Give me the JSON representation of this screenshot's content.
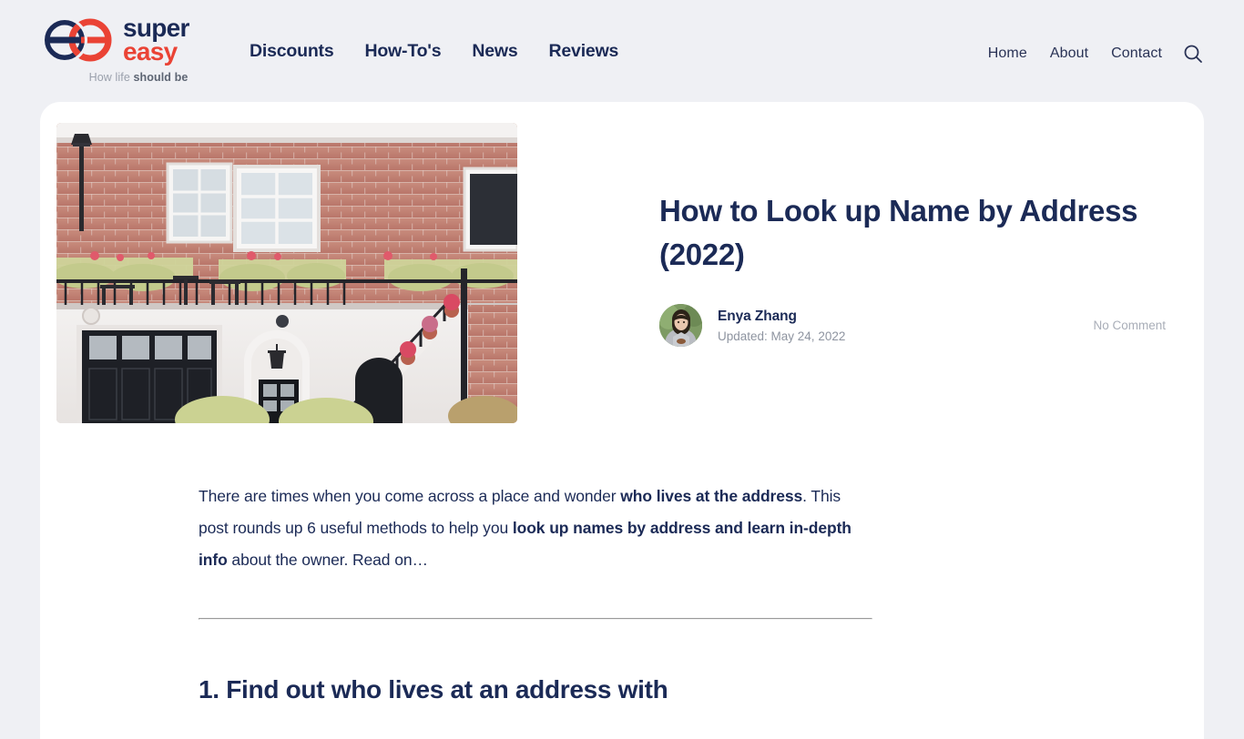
{
  "header": {
    "brand": {
      "word_top": "super",
      "word_bottom": "easy",
      "tagline_light": "How life ",
      "tagline_bold": "should be",
      "navy": "#1b2a56",
      "red": "#ea4335"
    },
    "main_nav": [
      {
        "label": "Discounts"
      },
      {
        "label": "How-To's"
      },
      {
        "label": "News"
      },
      {
        "label": "Reviews"
      }
    ],
    "util_nav": [
      {
        "label": "Home"
      },
      {
        "label": "About"
      },
      {
        "label": "Contact"
      }
    ],
    "search_icon": "search-icon"
  },
  "article": {
    "title": "How to Look up Name by Address (2022)",
    "hero_image_alt": "Red brick townhouse with white windows, balcony planters and a staircase lined with flower pots",
    "author": {
      "name": "Enya Zhang",
      "updated": "Updated: May 24, 2022",
      "avatar_alt": "Portrait photo of Enya Zhang"
    },
    "comment_count": "No Comment",
    "lede": {
      "part1": "There are times when you come across a place and wonder ",
      "bold1": "who lives at the address",
      "part2": ". This post rounds up 6 useful methods to help you ",
      "bold2": "look up names by address and learn in-depth info",
      "part3": " about the owner. Read on…"
    },
    "section_heading": "1. Find out who lives at an address with"
  },
  "colors": {
    "page_background": "#eff0f4",
    "card_background": "#ffffff",
    "text_navy": "#1b2a56",
    "text_muted": "#8e94a0",
    "divider": "#c9ccd3"
  }
}
